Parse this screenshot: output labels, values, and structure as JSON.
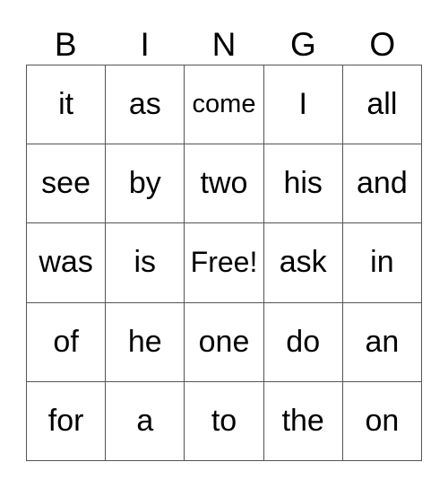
{
  "header": [
    "B",
    "I",
    "N",
    "G",
    "O"
  ],
  "rows": [
    [
      "it",
      "as",
      "come",
      "I",
      "all"
    ],
    [
      "see",
      "by",
      "two",
      "his",
      "and"
    ],
    [
      "was",
      "is",
      "Free!",
      "ask",
      "in"
    ],
    [
      "of",
      "he",
      "one",
      "do",
      "an"
    ],
    [
      "for",
      "a",
      "to",
      "the",
      "on"
    ]
  ]
}
